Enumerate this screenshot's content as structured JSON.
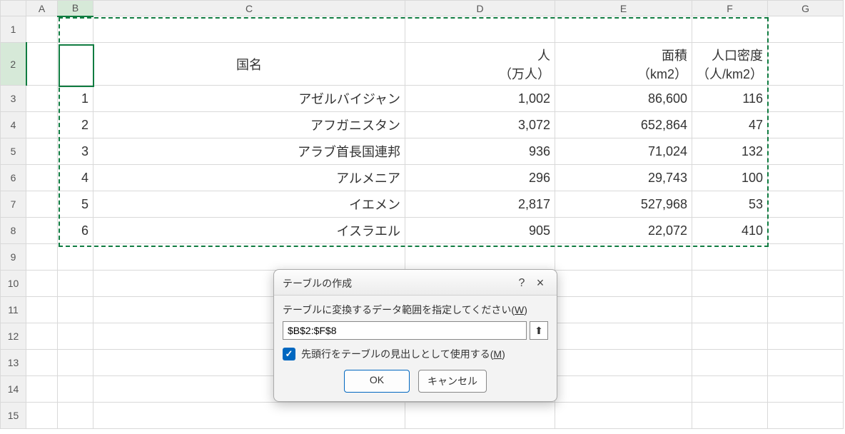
{
  "columns": [
    "A",
    "B",
    "C",
    "D",
    "E",
    "F",
    "G"
  ],
  "rows": [
    "1",
    "2",
    "3",
    "4",
    "5",
    "6",
    "7",
    "8",
    "9",
    "10",
    "11",
    "12",
    "13",
    "14",
    "15"
  ],
  "headers": {
    "C": "国名",
    "D_line1": "人",
    "D_line2": "（万人）",
    "E_line1": "面積",
    "E_line2": "（km2）",
    "F_line1": "人口密度",
    "F_line2": "（人/km2）"
  },
  "data": [
    {
      "idx": "1",
      "country": "アゼルバイジャン",
      "pop": "1,002",
      "area": "86,600",
      "density": "116"
    },
    {
      "idx": "2",
      "country": "アフガニスタン",
      "pop": "3,072",
      "area": "652,864",
      "density": "47"
    },
    {
      "idx": "3",
      "country": "アラブ首長国連邦",
      "pop": "936",
      "area": "71,024",
      "density": "132"
    },
    {
      "idx": "4",
      "country": "アルメニア",
      "pop": "296",
      "area": "29,743",
      "density": "100"
    },
    {
      "idx": "5",
      "country": "イエメン",
      "pop": "2,817",
      "area": "527,968",
      "density": "53"
    },
    {
      "idx": "6",
      "country": "イスラエル",
      "pop": "905",
      "area": "22,072",
      "density": "410"
    }
  ],
  "dialog": {
    "title": "テーブルの作成",
    "help": "?",
    "close": "×",
    "range_label_pre": "テーブルに変換するデータ範囲を指定してください(",
    "range_label_accel": "W",
    "range_label_post": ")",
    "range_value": "$B$2:$F$8",
    "range_picker_glyph": "⬆",
    "check_label_pre": "先頭行をテーブルの見出しとして使用する(",
    "check_label_accel": "M",
    "check_label_post": ")",
    "check_glyph": "✓",
    "ok": "OK",
    "cancel": "キャンセル"
  }
}
